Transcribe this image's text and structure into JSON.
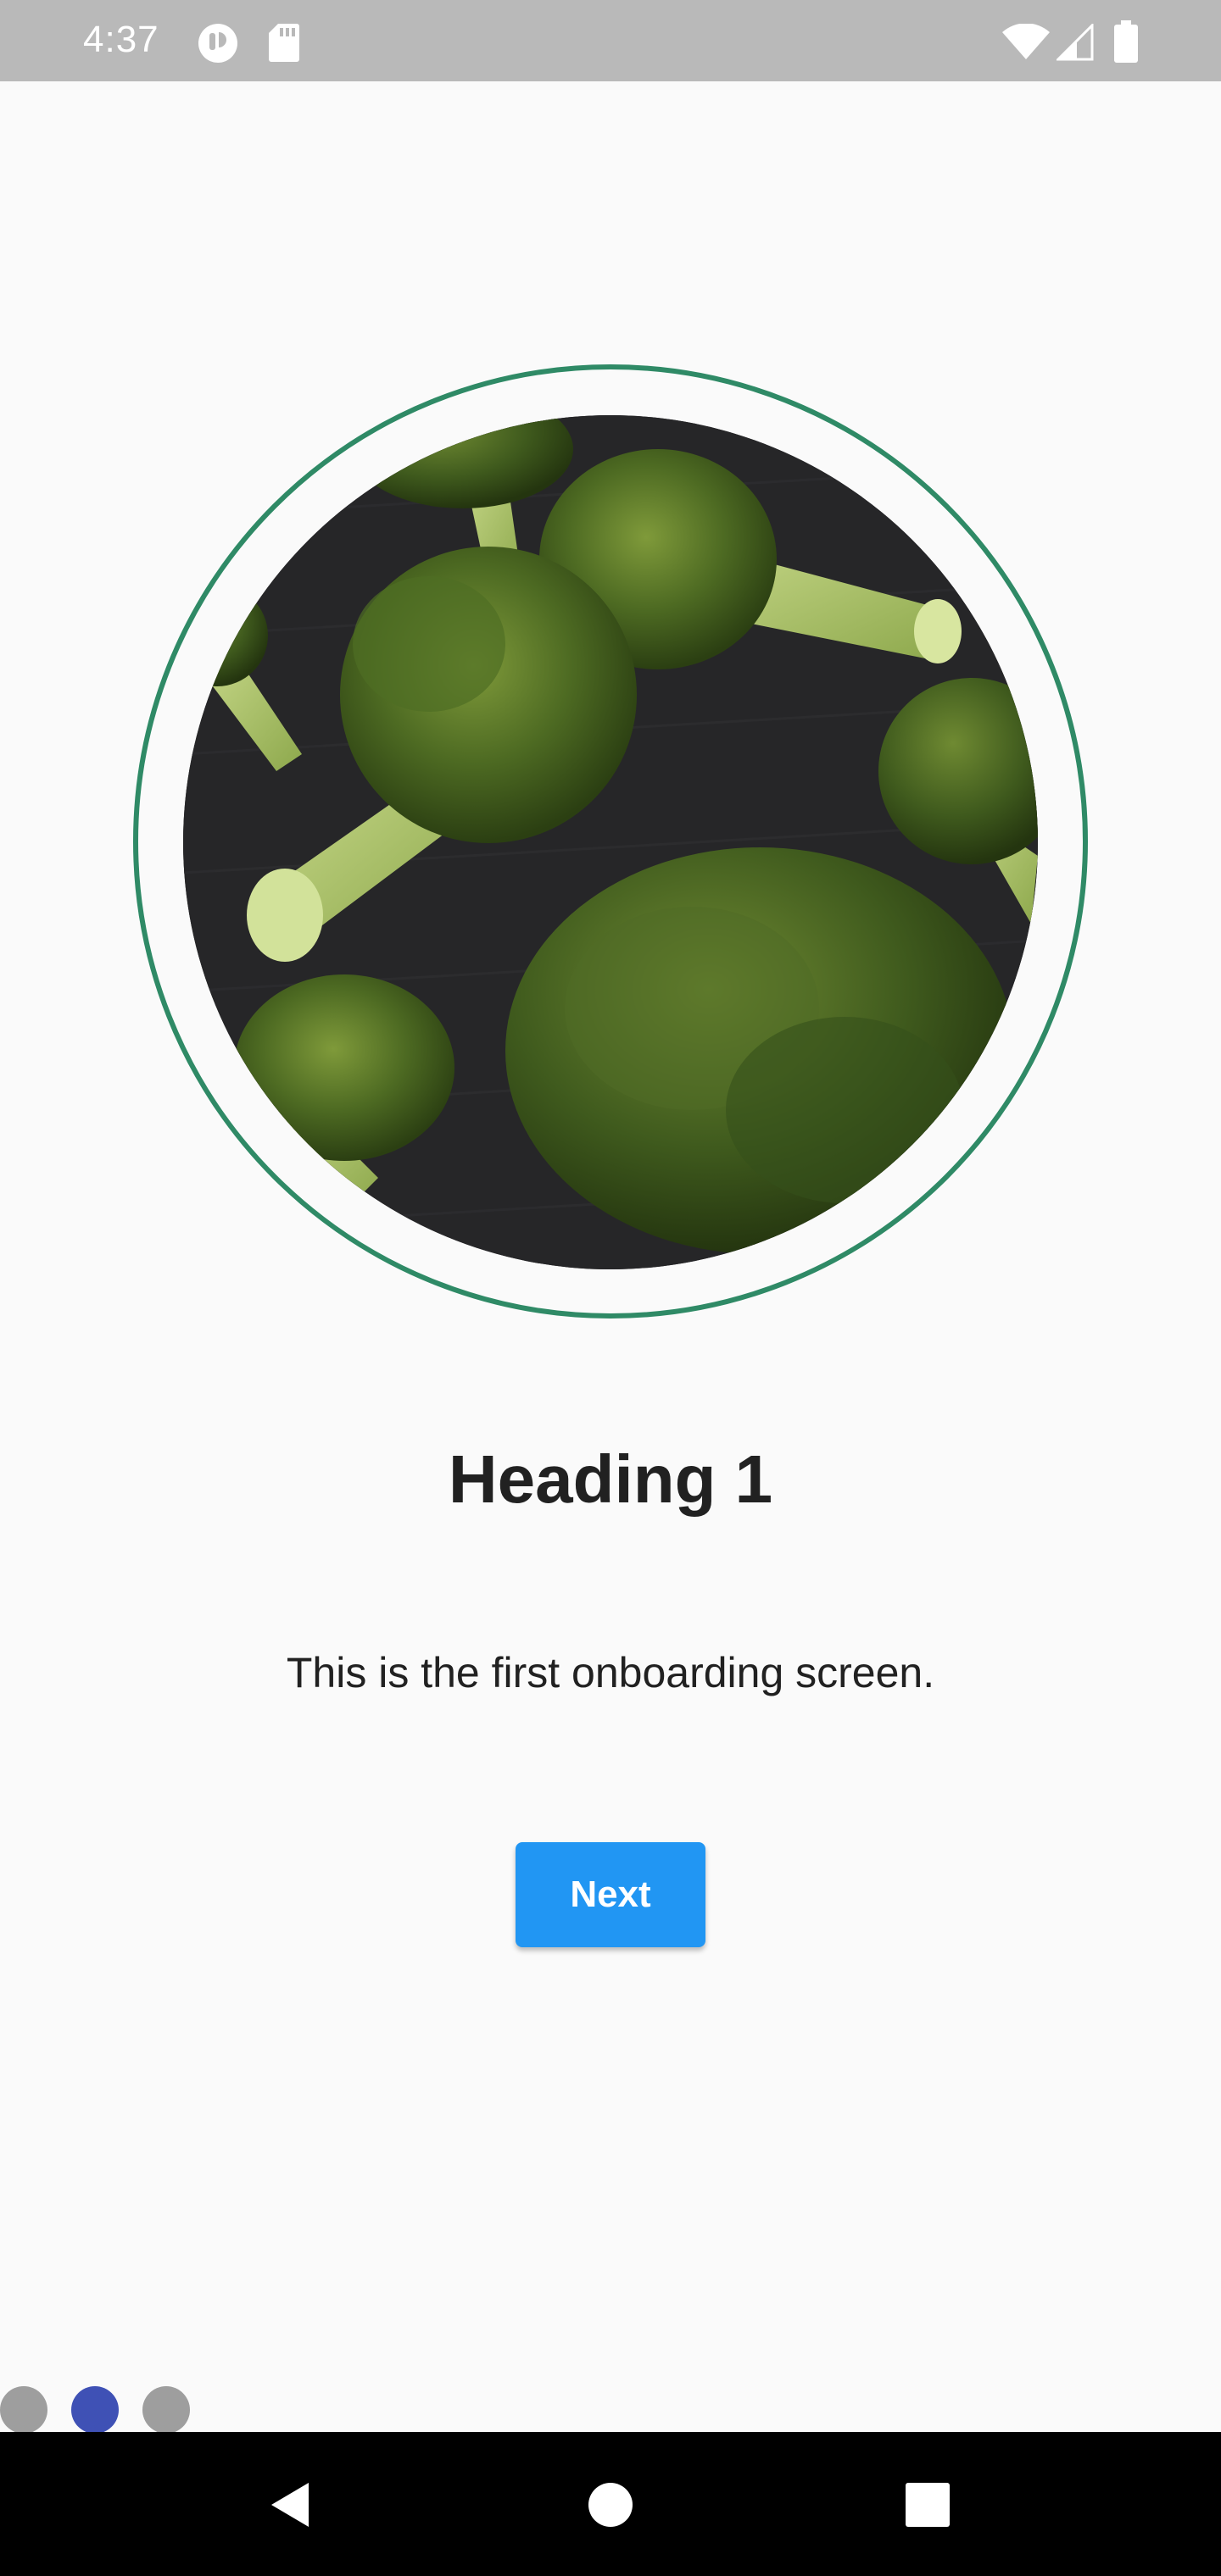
{
  "status_bar": {
    "time": "4:37",
    "icons": [
      "notification-app-icon",
      "sd-card-icon",
      "wifi-icon",
      "cellular-signal-icon",
      "battery-icon"
    ]
  },
  "onboarding": {
    "image_subject": "broccoli-image",
    "heading": "Heading 1",
    "body": "This is the first onboarding screen.",
    "next_label": "Next",
    "page_count": 3,
    "active_page": 2
  },
  "colors": {
    "ring": "#2f8a66",
    "button": "#2196f3",
    "dot_active": "#3f51b5",
    "dot_inactive": "#9e9e9e",
    "background": "#fafafa",
    "status_bar": "#b9b9b9"
  },
  "nav_bar": {
    "icons": [
      "back-icon",
      "home-icon",
      "recents-icon"
    ]
  }
}
